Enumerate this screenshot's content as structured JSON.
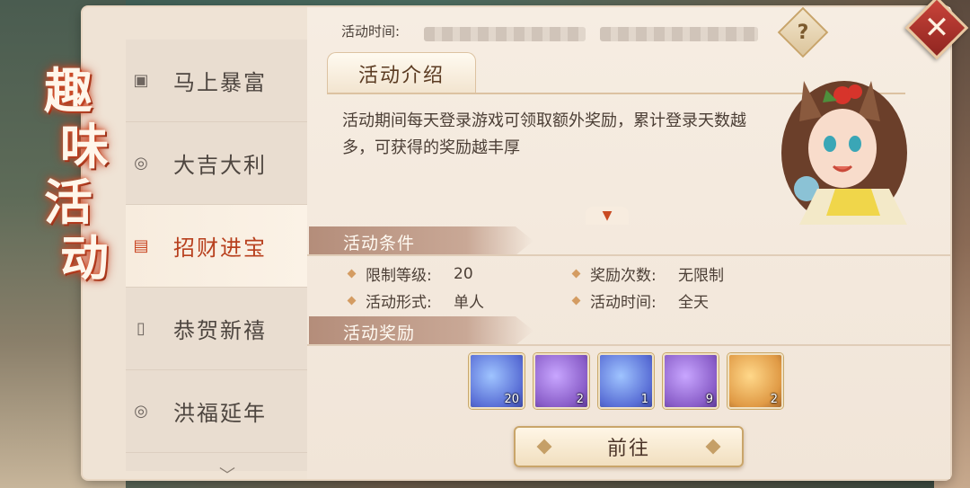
{
  "title_chars": [
    "趣",
    "味",
    "活",
    "动"
  ],
  "sidebar": {
    "items": [
      {
        "label": "马上暴富",
        "icon": "frame-icon"
      },
      {
        "label": "大吉大利",
        "icon": "coin-icon"
      },
      {
        "label": "招财进宝",
        "icon": "calendar-icon"
      },
      {
        "label": "恭贺新禧",
        "icon": "lantern-icon"
      },
      {
        "label": "洪福延年",
        "icon": "coin-icon"
      }
    ],
    "active_index": 2
  },
  "activity_time_label": "活动时间:",
  "intro": {
    "tab_label": "活动介绍",
    "text": "活动期间每天登录游戏可领取额外奖励，累计登录天数越多，可获得的奖励越丰厚"
  },
  "conditions": {
    "header": "活动条件",
    "rows": [
      {
        "key": "限制等级:",
        "value": "20"
      },
      {
        "key": "奖励次数:",
        "value": "无限制"
      },
      {
        "key": "活动形式:",
        "value": "单人"
      },
      {
        "key": "活动时间:",
        "value": "全天"
      }
    ]
  },
  "rewards": {
    "header": "活动奖励",
    "items": [
      {
        "name": "fan-item",
        "count": "20",
        "rarity": "blue"
      },
      {
        "name": "scroll-item",
        "count": "2",
        "rarity": "purple"
      },
      {
        "name": "map-item",
        "count": "1",
        "rarity": "blue"
      },
      {
        "name": "gift-bag-item",
        "count": "9",
        "rarity": "purple"
      },
      {
        "name": "chest-item",
        "count": "2",
        "rarity": "gold"
      }
    ]
  },
  "go_button": "前往",
  "help_glyph": "?",
  "close_glyph": "✕",
  "colors": {
    "accent": "#c8421f",
    "panel_bg": "#efe3d5",
    "close_red": "#b3342b"
  }
}
